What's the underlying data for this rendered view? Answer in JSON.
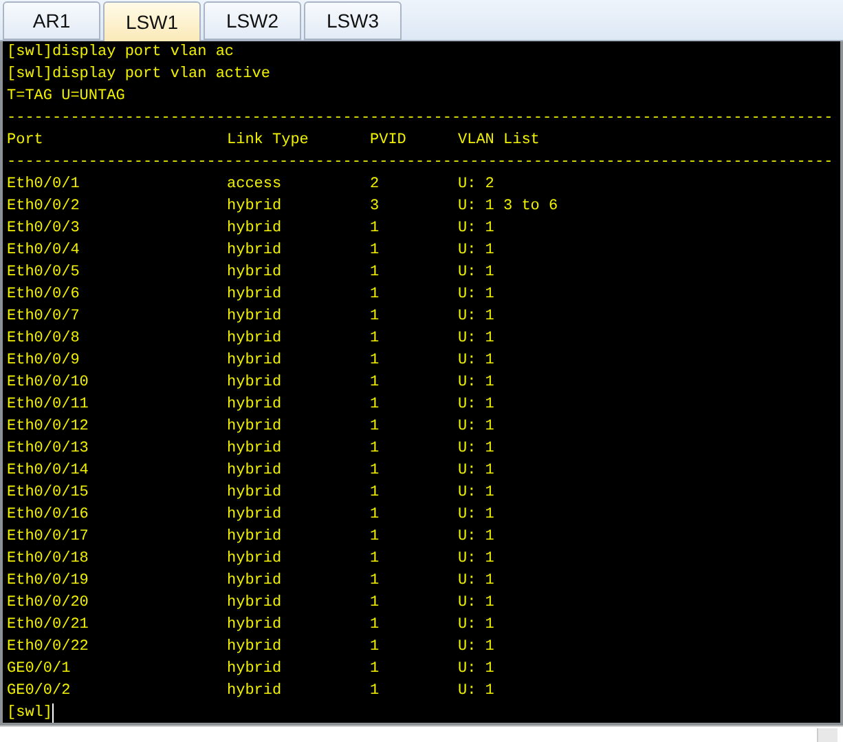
{
  "tabs": [
    {
      "label": "AR1",
      "selected": false
    },
    {
      "label": "LSW1",
      "selected": true
    },
    {
      "label": "LSW2",
      "selected": false
    },
    {
      "label": "LSW3",
      "selected": false
    }
  ],
  "terminal": {
    "lines": [
      "[swl]display port vlan ac",
      "[swl]display port vlan active",
      "T=TAG U=UNTAG"
    ],
    "rule": "-------------------------------------------------------------------------------------------",
    "columns": [
      "Port",
      "Link Type",
      "PVID",
      "VLAN List"
    ],
    "rows": [
      [
        "Eth0/0/1",
        "access",
        "2",
        "U: 2"
      ],
      [
        "Eth0/0/2",
        "hybrid",
        "3",
        "U: 1 3 to 6"
      ],
      [
        "Eth0/0/3",
        "hybrid",
        "1",
        "U: 1"
      ],
      [
        "Eth0/0/4",
        "hybrid",
        "1",
        "U: 1"
      ],
      [
        "Eth0/0/5",
        "hybrid",
        "1",
        "U: 1"
      ],
      [
        "Eth0/0/6",
        "hybrid",
        "1",
        "U: 1"
      ],
      [
        "Eth0/0/7",
        "hybrid",
        "1",
        "U: 1"
      ],
      [
        "Eth0/0/8",
        "hybrid",
        "1",
        "U: 1"
      ],
      [
        "Eth0/0/9",
        "hybrid",
        "1",
        "U: 1"
      ],
      [
        "Eth0/0/10",
        "hybrid",
        "1",
        "U: 1"
      ],
      [
        "Eth0/0/11",
        "hybrid",
        "1",
        "U: 1"
      ],
      [
        "Eth0/0/12",
        "hybrid",
        "1",
        "U: 1"
      ],
      [
        "Eth0/0/13",
        "hybrid",
        "1",
        "U: 1"
      ],
      [
        "Eth0/0/14",
        "hybrid",
        "1",
        "U: 1"
      ],
      [
        "Eth0/0/15",
        "hybrid",
        "1",
        "U: 1"
      ],
      [
        "Eth0/0/16",
        "hybrid",
        "1",
        "U: 1"
      ],
      [
        "Eth0/0/17",
        "hybrid",
        "1",
        "U: 1"
      ],
      [
        "Eth0/0/18",
        "hybrid",
        "1",
        "U: 1"
      ],
      [
        "Eth0/0/19",
        "hybrid",
        "1",
        "U: 1"
      ],
      [
        "Eth0/0/20",
        "hybrid",
        "1",
        "U: 1"
      ],
      [
        "Eth0/0/21",
        "hybrid",
        "1",
        "U: 1"
      ],
      [
        "Eth0/0/22",
        "hybrid",
        "1",
        "U: 1"
      ],
      [
        "GE0/0/1",
        "hybrid",
        "1",
        "U: 1"
      ],
      [
        "GE0/0/2",
        "hybrid",
        "1",
        "U: 1"
      ]
    ],
    "prompt": "[swl]"
  }
}
